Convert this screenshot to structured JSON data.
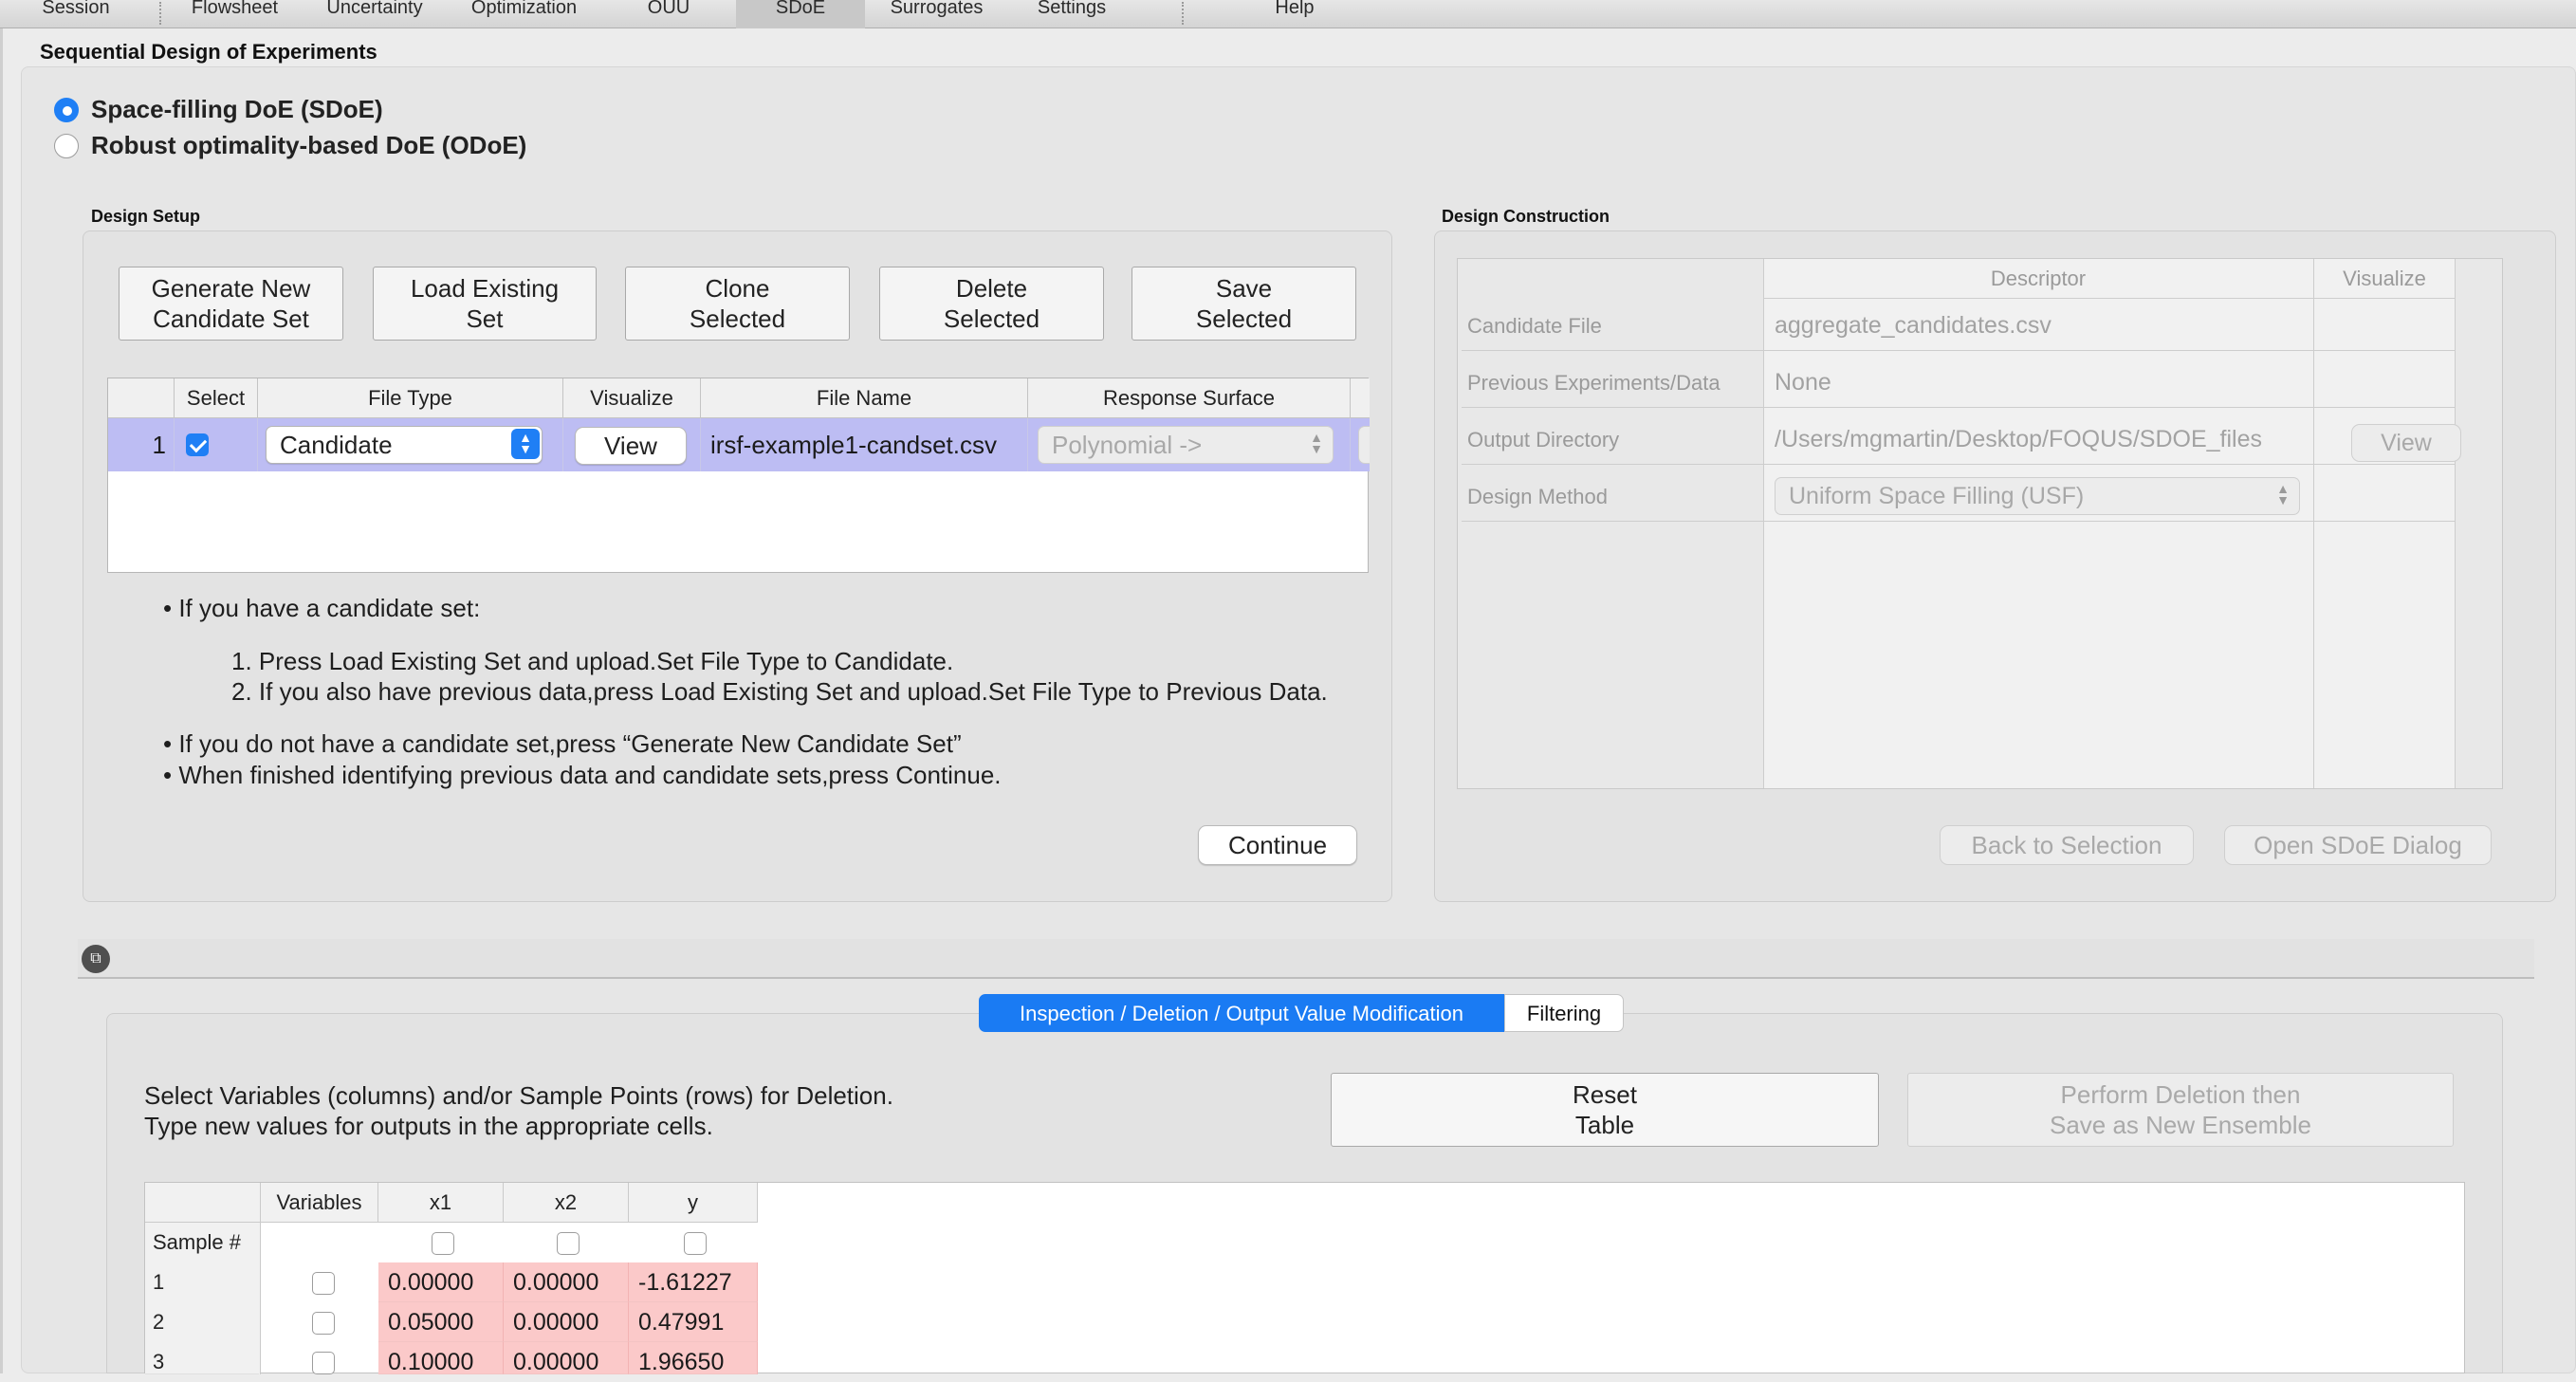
{
  "tabs": [
    {
      "label": "Session",
      "active": false
    },
    {
      "label": "Flowsheet",
      "active": false
    },
    {
      "label": "Uncertainty",
      "active": false
    },
    {
      "label": "Optimization",
      "active": false
    },
    {
      "label": "OUU",
      "active": false
    },
    {
      "label": "SDoE",
      "active": true
    },
    {
      "label": "Surrogates",
      "active": false
    },
    {
      "label": "Settings",
      "active": false
    },
    {
      "label": "Help",
      "active": false
    }
  ],
  "section_title": "Sequential Design of Experiments",
  "radio_options": [
    {
      "label": "Space-filling DoE (SDoE)",
      "selected": true
    },
    {
      "label": "Robust optimality-based DoE (ODoE)",
      "selected": false
    }
  ],
  "design_setup": {
    "title": "Design Setup",
    "buttons": [
      {
        "label": "Generate New\nCandidate Set"
      },
      {
        "label": "Load Existing\nSet"
      },
      {
        "label": "Clone\nSelected"
      },
      {
        "label": "Delete\nSelected"
      },
      {
        "label": "Save\nSelected"
      }
    ],
    "table": {
      "headers": [
        "",
        "Select",
        "File Type",
        "Visualize",
        "File Name",
        "Response Surface"
      ],
      "rows": [
        {
          "index": "1",
          "selected": true,
          "file_type": "Candidate",
          "visualize": "View",
          "file_name": "irsf-example1-candset.csv",
          "response_surface": "Polynomial ->"
        }
      ]
    },
    "instructions": {
      "bullet1": "If you have a candidate set:",
      "step1": "1. Press Load Existing Set and upload.Set File Type to Candidate.",
      "step2": "2. If you also have previous data,press Load Existing Set and upload.Set File Type to Previous Data.",
      "bullet2": "If you do not have a candidate set,press “Generate New Candidate Set”",
      "bullet3": "When finished identifying previous data and candidate sets,press Continue."
    },
    "continue_label": "Continue"
  },
  "design_construction": {
    "title": "Design Construction",
    "headers": {
      "descriptor": "Descriptor",
      "visualize": "Visualize"
    },
    "rows": [
      {
        "label": "Candidate File",
        "value": "aggregate_candidates.csv"
      },
      {
        "label": "Previous Experiments/Data",
        "value": "None"
      },
      {
        "label": "Output Directory",
        "value": "/Users/mgmartin/Desktop/FOQUS/SDOE_files",
        "action": "View"
      },
      {
        "label": "Design Method",
        "value": "Uniform Space Filling (USF)"
      }
    ],
    "back_label": "Back to Selection",
    "open_label": "Open SDoE Dialog"
  },
  "inspection": {
    "tabs": [
      {
        "label": "Inspection / Deletion / Output Value Modification",
        "active": true
      },
      {
        "label": "Filtering",
        "active": false
      }
    ],
    "help_line1": "Select Variables (columns) and/or Sample Points (rows) for Deletion.",
    "help_line2": "Type new values for outputs in the appropriate cells.",
    "reset_label": "Reset\nTable",
    "perform_label": "Perform Deletion then\nSave as New Ensemble",
    "table": {
      "headers": [
        "",
        "Variables",
        "x1",
        "x2",
        "y"
      ],
      "sample_label": "Sample #",
      "rows": [
        {
          "n": "1",
          "x1": "0.00000",
          "x2": "0.00000",
          "y": "-1.61227"
        },
        {
          "n": "2",
          "x1": "0.05000",
          "x2": "0.00000",
          "y": "0.47991"
        },
        {
          "n": "3",
          "x1": "0.10000",
          "x2": "0.00000",
          "y": "1.96650"
        }
      ]
    }
  },
  "colors": {
    "accent": "#1f7ff5",
    "selected_row": "#bdbdf3",
    "modified_cell": "#fbc9c9"
  }
}
